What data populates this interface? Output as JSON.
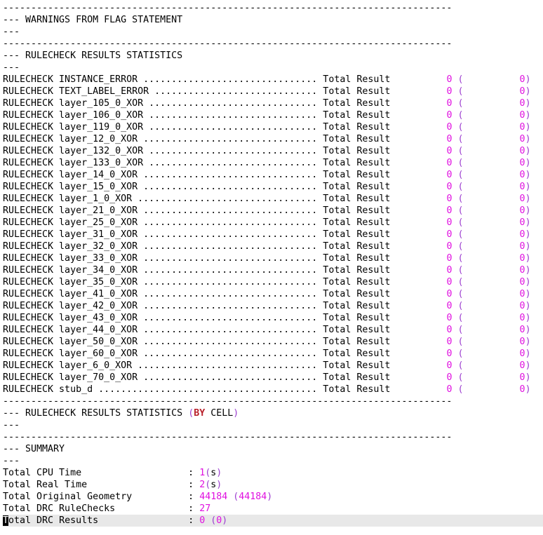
{
  "colors": {
    "text": "#000000",
    "number": "#e010e0",
    "paren": "#9c3ecf",
    "keyword": "#b8202a",
    "current_line_bg": "#e8e8e8"
  },
  "lines": [
    {
      "type": "sep",
      "text": "--------------------------------------------------------------------------------"
    },
    {
      "type": "text",
      "text": "--- WARNINGS FROM FLAG STATEMENT"
    },
    {
      "type": "text",
      "text": "---"
    },
    {
      "type": "sep",
      "text": "--------------------------------------------------------------------------------"
    },
    {
      "type": "text",
      "text": "--- RULECHECK RESULTS STATISTICS"
    },
    {
      "type": "text",
      "text": "---"
    },
    {
      "type": "rule",
      "prefix": "RULECHECK INSTANCE_ERROR ............................... Total Result",
      "count": "0",
      "total": "0"
    },
    {
      "type": "rule",
      "prefix": "RULECHECK TEXT_LABEL_ERROR ............................. Total Result",
      "count": "0",
      "total": "0"
    },
    {
      "type": "rule",
      "prefix": "RULECHECK layer_105_0_XOR .............................. Total Result",
      "count": "0",
      "total": "0"
    },
    {
      "type": "rule",
      "prefix": "RULECHECK layer_106_0_XOR .............................. Total Result",
      "count": "0",
      "total": "0"
    },
    {
      "type": "rule",
      "prefix": "RULECHECK layer_119_0_XOR .............................. Total Result",
      "count": "0",
      "total": "0"
    },
    {
      "type": "rule",
      "prefix": "RULECHECK layer_12_0_XOR ............................... Total Result",
      "count": "0",
      "total": "0"
    },
    {
      "type": "rule",
      "prefix": "RULECHECK layer_132_0_XOR .............................. Total Result",
      "count": "0",
      "total": "0"
    },
    {
      "type": "rule",
      "prefix": "RULECHECK layer_133_0_XOR .............................. Total Result",
      "count": "0",
      "total": "0"
    },
    {
      "type": "rule",
      "prefix": "RULECHECK layer_14_0_XOR ............................... Total Result",
      "count": "0",
      "total": "0"
    },
    {
      "type": "rule",
      "prefix": "RULECHECK layer_15_0_XOR ............................... Total Result",
      "count": "0",
      "total": "0"
    },
    {
      "type": "rule",
      "prefix": "RULECHECK layer_1_0_XOR ................................ Total Result",
      "count": "0",
      "total": "0"
    },
    {
      "type": "rule",
      "prefix": "RULECHECK layer_21_0_XOR ............................... Total Result",
      "count": "0",
      "total": "0"
    },
    {
      "type": "rule",
      "prefix": "RULECHECK layer_25_0_XOR ............................... Total Result",
      "count": "0",
      "total": "0"
    },
    {
      "type": "rule",
      "prefix": "RULECHECK layer_31_0_XOR ............................... Total Result",
      "count": "0",
      "total": "0"
    },
    {
      "type": "rule",
      "prefix": "RULECHECK layer_32_0_XOR ............................... Total Result",
      "count": "0",
      "total": "0"
    },
    {
      "type": "rule",
      "prefix": "RULECHECK layer_33_0_XOR ............................... Total Result",
      "count": "0",
      "total": "0"
    },
    {
      "type": "rule",
      "prefix": "RULECHECK layer_34_0_XOR ............................... Total Result",
      "count": "0",
      "total": "0"
    },
    {
      "type": "rule",
      "prefix": "RULECHECK layer_35_0_XOR ............................... Total Result",
      "count": "0",
      "total": "0"
    },
    {
      "type": "rule",
      "prefix": "RULECHECK layer_41_0_XOR ............................... Total Result",
      "count": "0",
      "total": "0"
    },
    {
      "type": "rule",
      "prefix": "RULECHECK layer_42_0_XOR ............................... Total Result",
      "count": "0",
      "total": "0"
    },
    {
      "type": "rule",
      "prefix": "RULECHECK layer_43_0_XOR ............................... Total Result",
      "count": "0",
      "total": "0"
    },
    {
      "type": "rule",
      "prefix": "RULECHECK layer_44_0_XOR ............................... Total Result",
      "count": "0",
      "total": "0"
    },
    {
      "type": "rule",
      "prefix": "RULECHECK layer_50_0_XOR ............................... Total Result",
      "count": "0",
      "total": "0"
    },
    {
      "type": "rule",
      "prefix": "RULECHECK layer_60_0_XOR ............................... Total Result",
      "count": "0",
      "total": "0"
    },
    {
      "type": "rule",
      "prefix": "RULECHECK layer_6_0_XOR ................................ Total Result",
      "count": "0",
      "total": "0"
    },
    {
      "type": "rule",
      "prefix": "RULECHECK layer_70_0_XOR ............................... Total Result",
      "count": "0",
      "total": "0"
    },
    {
      "type": "rule",
      "prefix": "RULECHECK stub_d ....................................... Total Result",
      "count": "0",
      "total": "0"
    },
    {
      "type": "sep",
      "text": "--------------------------------------------------------------------------------"
    },
    {
      "type": "bycell",
      "text": "--- RULECHECK RESULTS STATISTICS ",
      "open": "(",
      "kw": "BY",
      "word": " CELL",
      "close": ")"
    },
    {
      "type": "text",
      "text": "---"
    },
    {
      "type": "sep",
      "text": "--------------------------------------------------------------------------------"
    },
    {
      "type": "text",
      "text": "--- SUMMARY"
    },
    {
      "type": "text",
      "text": "---"
    },
    {
      "type": "summary",
      "label": "Total CPU Time                   : ",
      "value": "1",
      "open": "(",
      "unit": "s",
      "close": ")"
    },
    {
      "type": "summary",
      "label": "Total Real Time                  : ",
      "value": "2",
      "open": "(",
      "unit": "s",
      "close": ")"
    },
    {
      "type": "summary",
      "label": "Total Original Geometry          : ",
      "value": "44184",
      "open": " (",
      "unit": "44184",
      "close": ")",
      "unit_is_num": true
    },
    {
      "type": "summary",
      "label": "Total DRC RuleChecks             : ",
      "value": "27"
    },
    {
      "type": "summary",
      "label": "Total DRC Results                : ",
      "value": "0",
      "open": " (",
      "unit": "0",
      "close": ")",
      "unit_is_num": true,
      "current": true
    }
  ]
}
